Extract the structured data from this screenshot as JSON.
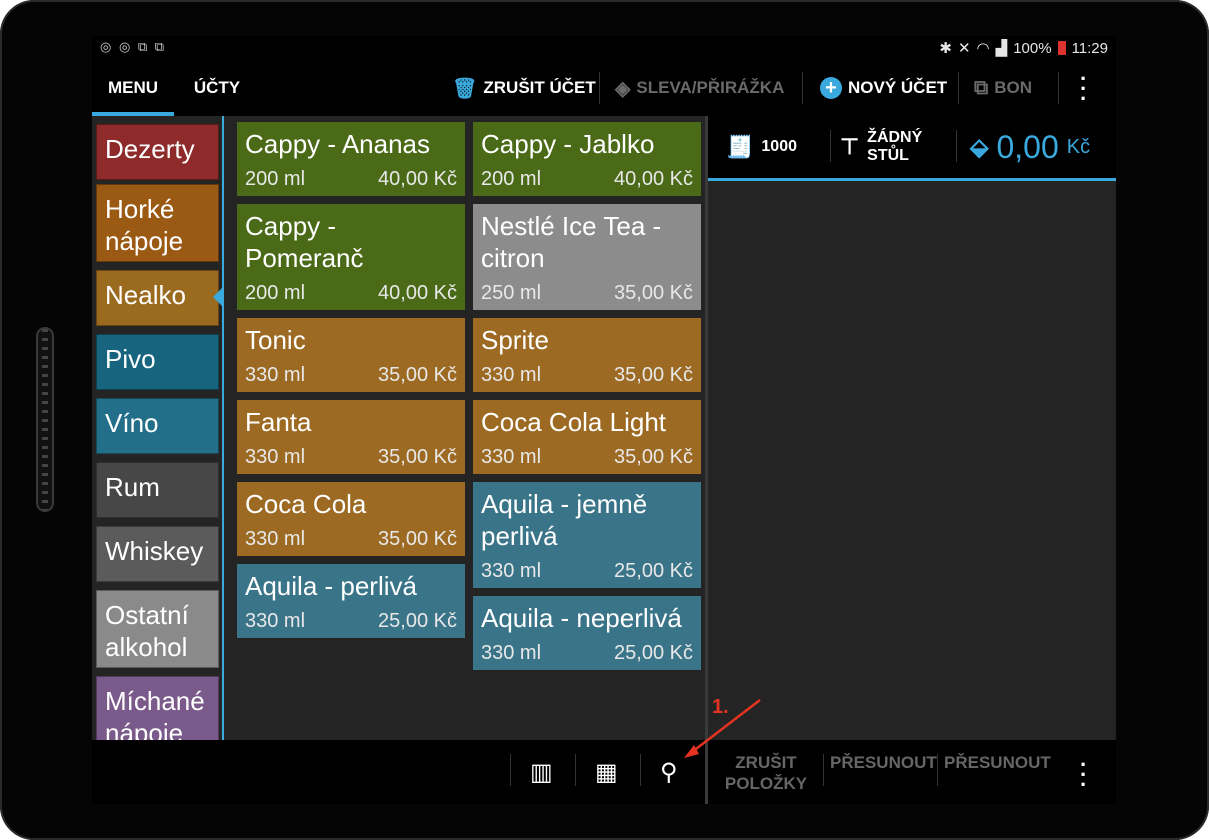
{
  "statusbar": {
    "left_icons": "◎ ◎ ⧉ ⧉",
    "battery": "100%",
    "time": "11:29"
  },
  "tabs": [
    {
      "label": "MENU"
    },
    {
      "label": "ÚČTY"
    }
  ],
  "actions": {
    "cancel_account": "ZRUŠIT ÚČET",
    "discount": "SLEVA/PŘIRÁŽKA",
    "new_account": "NOVÝ ÚČET",
    "bon": "BON"
  },
  "categories": [
    {
      "label": "Dezerty",
      "color": "#8e2a2a"
    },
    {
      "label": "Horké nápoje",
      "color": "#9a5a14"
    },
    {
      "label": "Nealko",
      "color": "#9a6a1e"
    },
    {
      "label": "Pivo",
      "color": "#16647e"
    },
    {
      "label": "Víno",
      "color": "#236f8a"
    },
    {
      "label": "Rum",
      "color": "#474747"
    },
    {
      "label": "Whiskey",
      "color": "#5b5b5b"
    },
    {
      "label": "Ostatní alkohol",
      "color": "#8a8a8a"
    },
    {
      "label": "Míchané nápoje",
      "color": "#7a5a8a"
    }
  ],
  "products": [
    {
      "name": "Cappy - Ananas",
      "size": "200 ml",
      "price": "40,00 Kč",
      "color": "#4a6a18"
    },
    {
      "name": "Cappy - Jablko",
      "size": "200 ml",
      "price": "40,00 Kč",
      "color": "#4a6a18"
    },
    {
      "name": "Cappy - Pomeranč",
      "size": "200 ml",
      "price": "40,00 Kč",
      "color": "#4a6a18"
    },
    {
      "name": "Nestlé Ice Tea - citron",
      "size": "250 ml",
      "price": "35,00 Kč",
      "color": "#8c8c8c"
    },
    {
      "name": "Tonic",
      "size": "330 ml",
      "price": "35,00 Kč",
      "color": "#9c6a22"
    },
    {
      "name": "Sprite",
      "size": "330 ml",
      "price": "35,00 Kč",
      "color": "#9c6a22"
    },
    {
      "name": "Fanta",
      "size": "330 ml",
      "price": "35,00 Kč",
      "color": "#9c6a22"
    },
    {
      "name": "Coca Cola Light",
      "size": "330 ml",
      "price": "35,00 Kč",
      "color": "#9c6a22"
    },
    {
      "name": "Coca Cola",
      "size": "330 ml",
      "price": "35,00 Kč",
      "color": "#9c6a22"
    },
    {
      "name": "Aquila - jemně perlivá",
      "size": "330 ml",
      "price": "25,00 Kč",
      "color": "#3a7489"
    },
    {
      "name": "Aquila - perlivá",
      "size": "330 ml",
      "price": "25,00 Kč",
      "color": "#3a7489"
    },
    {
      "name": "Aquila - neperlivá",
      "size": "330 ml",
      "price": "25,00 Kč",
      "color": "#3a7489"
    }
  ],
  "order": {
    "receipt_no": "1000",
    "table": "ŽÁDNÝ STŮL",
    "total_value": "0,00",
    "currency": "Kč"
  },
  "bottom": {
    "cancel_items": "ZRUŠIT POLOŽKY",
    "move1": "PŘESUNOUT",
    "move2": "PŘESUNOUT"
  },
  "annotation": {
    "label": "1."
  },
  "colors": {
    "accent": "#3aa9dd",
    "annotation": "#e53322"
  }
}
